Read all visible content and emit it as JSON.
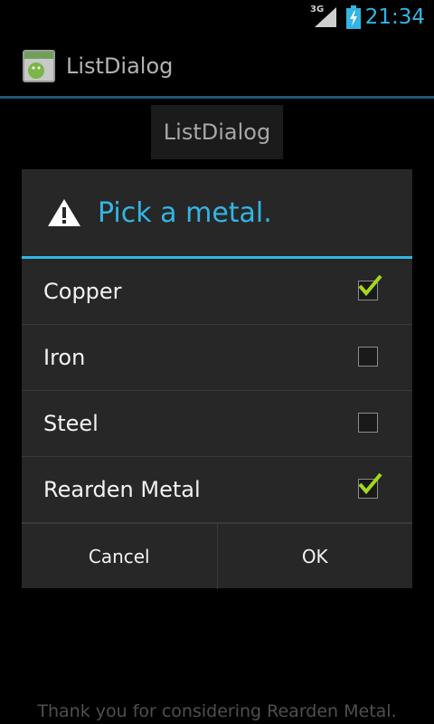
{
  "status_bar": {
    "network": "3G",
    "clock": "21:34",
    "icons": [
      "signal-icon",
      "battery-charging-icon"
    ]
  },
  "action_bar": {
    "title": "ListDialog",
    "icon": "android-app-icon"
  },
  "main": {
    "button_label": "ListDialog",
    "footer_text": "Thank you for considering Rearden Metal."
  },
  "dialog": {
    "icon": "warning-icon",
    "title": "Pick a metal.",
    "options": [
      {
        "label": "Copper",
        "checked": true
      },
      {
        "label": "Iron",
        "checked": false
      },
      {
        "label": "Steel",
        "checked": false
      },
      {
        "label": "Rearden Metal",
        "checked": true
      }
    ],
    "buttons": {
      "cancel": "Cancel",
      "ok": "OK"
    }
  },
  "colors": {
    "accent": "#33b5e5",
    "dialog_bg": "#272727",
    "check": "#a4d81e"
  }
}
